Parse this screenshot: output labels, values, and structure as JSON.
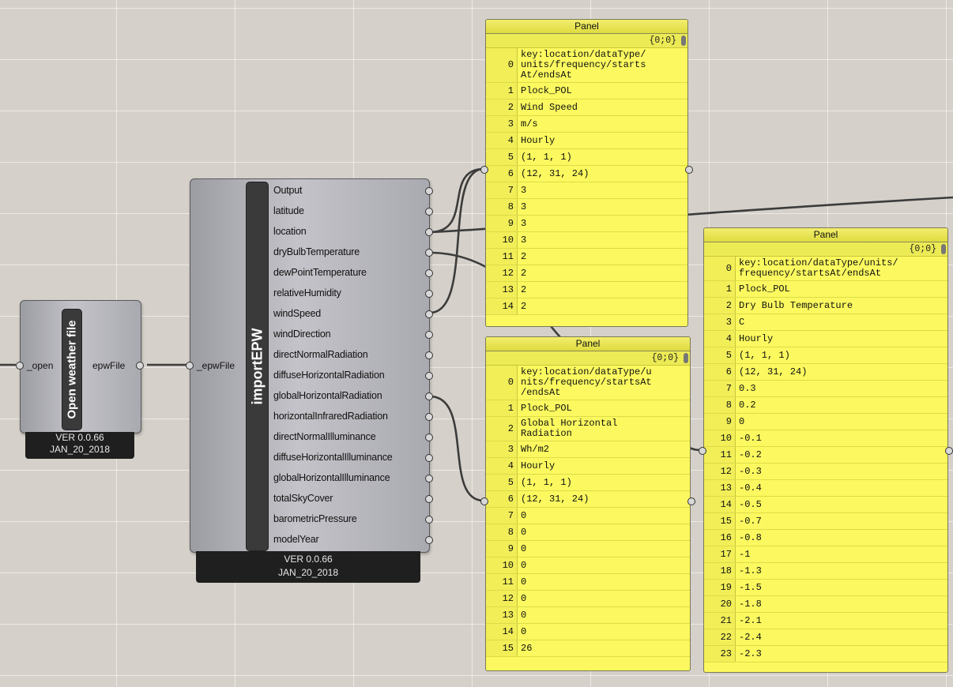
{
  "open_component": {
    "input": "_open",
    "title": "Open weather file",
    "output": "epwFile",
    "version": "VER 0.0.66",
    "date": "JAN_20_2018"
  },
  "import_component": {
    "input": "_epwFile",
    "title": "importEPW",
    "version": "VER 0.0.66",
    "date": "JAN_20_2018",
    "outputs": [
      "Output",
      "latitude",
      "location",
      "dryBulbTemperature",
      "dewPointTemperature",
      "relativeHumidity",
      "windSpeed",
      "windDirection",
      "directNormalRadiation",
      "diffuseHorizontalRadiation",
      "globalHorizontalRadiation",
      "horizontalInfraredRadiation",
      "directNormalIlluminance",
      "diffuseHorizontalIlluminance",
      "globalHorizontalIlluminance",
      "totalSkyCover",
      "barometricPressure",
      "modelYear"
    ]
  },
  "panel_wind": {
    "title": "Panel",
    "path": "{0;0}",
    "rows": [
      {
        "i": "0",
        "v": "key:location/dataType/\nunits/frequency/starts\nAt/endsAt"
      },
      {
        "i": "1",
        "v": "Plock_POL"
      },
      {
        "i": "2",
        "v": "Wind Speed"
      },
      {
        "i": "3",
        "v": "m/s"
      },
      {
        "i": "4",
        "v": "Hourly"
      },
      {
        "i": "5",
        "v": "(1, 1, 1)"
      },
      {
        "i": "6",
        "v": "(12, 31, 24)"
      },
      {
        "i": "7",
        "v": "3"
      },
      {
        "i": "8",
        "v": "3"
      },
      {
        "i": "9",
        "v": "3"
      },
      {
        "i": "10",
        "v": "3"
      },
      {
        "i": "11",
        "v": "2"
      },
      {
        "i": "12",
        "v": "2"
      },
      {
        "i": "13",
        "v": "2"
      },
      {
        "i": "14",
        "v": "2"
      }
    ]
  },
  "panel_global": {
    "title": "Panel",
    "path": "{0;0}",
    "rows": [
      {
        "i": "0",
        "v": "key:location/dataType/u\nnits/frequency/startsAt\n/endsAt"
      },
      {
        "i": "1",
        "v": "Plock_POL"
      },
      {
        "i": "2",
        "v": "Global Horizontal\nRadiation"
      },
      {
        "i": "3",
        "v": "Wh/m2"
      },
      {
        "i": "4",
        "v": "Hourly"
      },
      {
        "i": "5",
        "v": "(1, 1, 1)"
      },
      {
        "i": "6",
        "v": "(12, 31, 24)"
      },
      {
        "i": "7",
        "v": "0"
      },
      {
        "i": "8",
        "v": "0"
      },
      {
        "i": "9",
        "v": "0"
      },
      {
        "i": "10",
        "v": "0"
      },
      {
        "i": "11",
        "v": "0"
      },
      {
        "i": "12",
        "v": "0"
      },
      {
        "i": "13",
        "v": "0"
      },
      {
        "i": "14",
        "v": "0"
      },
      {
        "i": "15",
        "v": "26"
      }
    ]
  },
  "panel_drybulb": {
    "title": "Panel",
    "path": "{0;0}",
    "rows": [
      {
        "i": "0",
        "v": "key:location/dataType/units/\nfrequency/startsAt/endsAt"
      },
      {
        "i": "1",
        "v": "Plock_POL"
      },
      {
        "i": "2",
        "v": "Dry Bulb Temperature"
      },
      {
        "i": "3",
        "v": "C"
      },
      {
        "i": "4",
        "v": "Hourly"
      },
      {
        "i": "5",
        "v": "(1, 1, 1)"
      },
      {
        "i": "6",
        "v": "(12, 31, 24)"
      },
      {
        "i": "7",
        "v": "0.3"
      },
      {
        "i": "8",
        "v": "0.2"
      },
      {
        "i": "9",
        "v": "0"
      },
      {
        "i": "10",
        "v": "-0.1"
      },
      {
        "i": "11",
        "v": "-0.2"
      },
      {
        "i": "12",
        "v": "-0.3"
      },
      {
        "i": "13",
        "v": "-0.4"
      },
      {
        "i": "14",
        "v": "-0.5"
      },
      {
        "i": "15",
        "v": "-0.7"
      },
      {
        "i": "16",
        "v": "-0.8"
      },
      {
        "i": "17",
        "v": "-1"
      },
      {
        "i": "18",
        "v": "-1.3"
      },
      {
        "i": "19",
        "v": "-1.5"
      },
      {
        "i": "20",
        "v": "-1.8"
      },
      {
        "i": "21",
        "v": "-2.1"
      },
      {
        "i": "22",
        "v": "-2.4"
      },
      {
        "i": "23",
        "v": "-2.3"
      }
    ]
  }
}
